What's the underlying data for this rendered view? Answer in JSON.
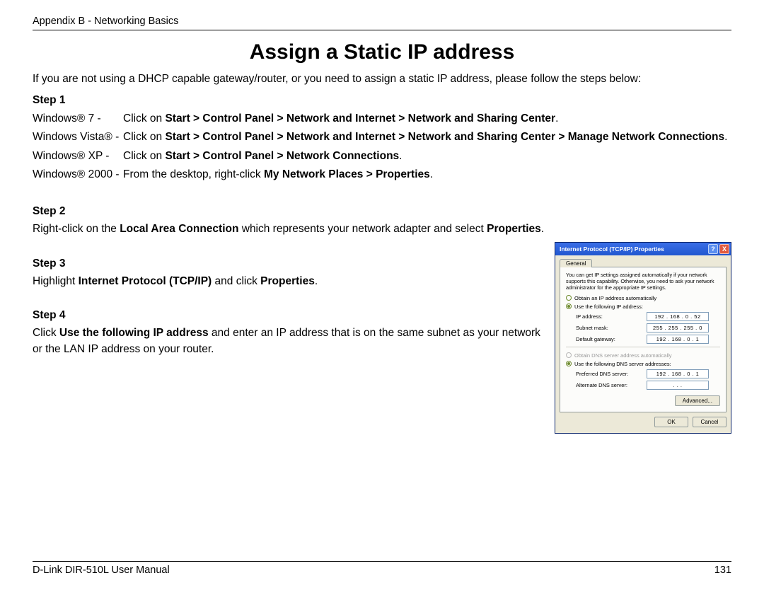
{
  "header": {
    "appendix": "Appendix B - Networking Basics"
  },
  "title": "Assign a Static IP address",
  "intro": "If you are not using a DHCP capable gateway/router, or you need to assign a static IP address, please follow the steps below:",
  "step1": {
    "heading": "Step 1",
    "rows": [
      {
        "os": "Windows® 7 -",
        "pre": "Click on ",
        "bold": "Start > Control Panel > Network and Internet > Network and Sharing Center",
        "post": "."
      },
      {
        "os": "Windows Vista® -",
        "pre": "Click on ",
        "bold": "Start > Control Panel > Network and Internet > Network and Sharing Center > Manage Network Connections",
        "post": "."
      },
      {
        "os": "Windows® XP -",
        "pre": "Click on ",
        "bold": "Start > Control Panel > Network Connections",
        "post": "."
      },
      {
        "os": "Windows® 2000 -",
        "pre": "From the desktop, right-click ",
        "bold": "My Network Places > Properties",
        "post": "."
      }
    ]
  },
  "step2": {
    "heading": "Step 2",
    "p1a": "Right-click on the ",
    "p1b": "Local Area Connection",
    "p1c": " which represents your network adapter and select ",
    "p1d": "Properties",
    "p1e": "."
  },
  "step3": {
    "heading": "Step 3",
    "p1a": "Highlight ",
    "p1b": "Internet Protocol (TCP/IP)",
    "p1c": " and click ",
    "p1d": "Properties",
    "p1e": "."
  },
  "step4": {
    "heading": "Step 4",
    "p1a": "Click ",
    "p1b": "Use the following IP address",
    "p1c": " and enter an IP address that is on the same subnet as your network or the LAN IP address on your router."
  },
  "dialog": {
    "title": "Internet Protocol (TCP/IP) Properties",
    "tab": "General",
    "info": "You can get IP settings assigned automatically if your network supports this capability. Otherwise, you need to ask your network administrator for the appropriate IP settings.",
    "r_auto_ip": "Obtain an IP address automatically",
    "r_use_ip": "Use the following IP address:",
    "f_ip_lbl": "IP address:",
    "f_ip_val": "192 . 168 .   0  .  52",
    "f_mask_lbl": "Subnet mask:",
    "f_mask_val": "255 . 255 . 255 .   0",
    "f_gw_lbl": "Default gateway:",
    "f_gw_val": "192 . 168 .   0  .   1",
    "r_auto_dns": "Obtain DNS server address automatically",
    "r_use_dns": "Use the following DNS server addresses:",
    "f_dns1_lbl": "Preferred DNS server:",
    "f_dns1_val": "192 . 168 .   0  .   1",
    "f_dns2_lbl": "Alternate DNS server:",
    "f_dns2_val": ".       .       .",
    "advanced": "Advanced...",
    "ok": "OK",
    "cancel": "Cancel",
    "help": "?",
    "close": "X"
  },
  "footer": {
    "left": "D-Link DIR-510L User Manual",
    "right": "131"
  }
}
